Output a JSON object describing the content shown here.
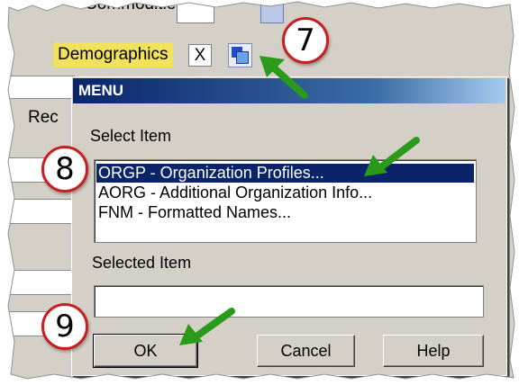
{
  "background": {
    "top_field_label": "Commodities",
    "demographics_label": "Demographics",
    "demographics_value": "X",
    "left_label": "Rec"
  },
  "dialog": {
    "title": "MENU",
    "select_item_label": "Select Item",
    "items": [
      "ORGP - Organization Profiles...",
      "AORG - Additional Organization Info...",
      "FNM - Formatted Names..."
    ],
    "selected_index": 0,
    "selected_item_label": "Selected Item",
    "selected_item_value": "",
    "buttons": {
      "ok": "OK",
      "cancel": "Cancel",
      "help": "Help"
    }
  },
  "callouts": [
    "7",
    "8",
    "9"
  ],
  "colors": {
    "highlight_label": "#f2e25a",
    "title_bar": "#0a246a",
    "callout_border": "#c81e1e",
    "arrow": "#2a9a1a"
  }
}
